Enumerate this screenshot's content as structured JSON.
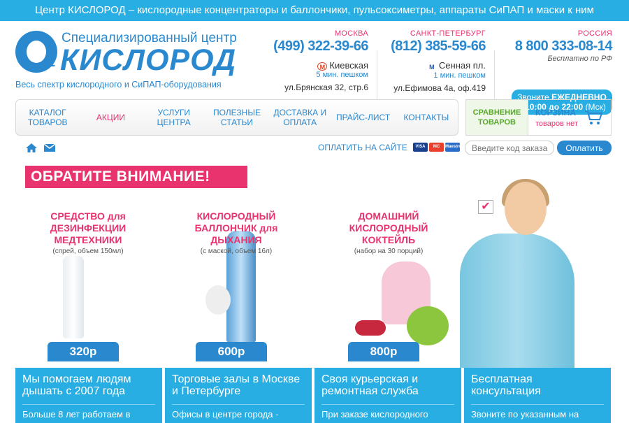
{
  "topbar": {
    "text": "Центр КИСЛОРОД – кислородные концентраторы и баллончики, пульсоксиметры, аппараты СиПАП и маски к ним"
  },
  "logo": {
    "line1": "Специализированный центр",
    "name": "КИСЛОРОД",
    "tagline": "Весь спектр кислородного и СиПАП-оборудования",
    "mark": "2"
  },
  "contacts": [
    {
      "city": "МОСКВА",
      "phone": "(499) 322-39-66",
      "metro": "Киевская",
      "walk": "5 мин. пешком",
      "address": "ул.Брянская 32, стр.6"
    },
    {
      "city": "САНКТ-ПЕТЕРБУРГ",
      "phone": "(812) 385-59-66",
      "metro": "Сенная пл.",
      "walk": "1 мин. пешком",
      "address": "ул.Ефимова 4а, оф.419"
    },
    {
      "city": "РОССИЯ",
      "phone": "8 800 333-08-14",
      "note": "Бесплатно по РФ"
    }
  ],
  "callbox": {
    "prefix": "Звоните",
    "bold1": "ЕЖЕДНЕВНО",
    "line2_bold": "с 10:00 до 22:00",
    "line2_tail": "(Мск)"
  },
  "nav": [
    "КАТАЛОГ ТОВАРОВ",
    "АКЦИИ",
    "УСЛУГИ ЦЕНТРА",
    "ПОЛЕЗНЫЕ СТАТЬИ",
    "ДОСТАВКА И ОПЛАТА",
    "ПРАЙС-ЛИСТ",
    "КОНТАКТЫ"
  ],
  "compare": {
    "label": "СРАВНЕНИЕ ТОВАРОВ"
  },
  "cart": {
    "title": "КОРЗИНА",
    "status": "товаров нет"
  },
  "payment": {
    "label": "ОПЛАТИТЬ НА САЙТЕ",
    "placeholder": "Введите код заказа",
    "button": "Оплатить",
    "cards": [
      "VISA",
      "MC",
      "Maestro"
    ]
  },
  "banner": {
    "notice": "ОБРАТИТЕ ВНИМАНИЕ!",
    "products": [
      {
        "title": "СРЕДСТВО для ДЕЗИНФЕКЦИИ МЕДТЕХНИКИ",
        "sub": "(спрей, объем 150мл)",
        "price": "320р"
      },
      {
        "title": "КИСЛОРОДНЫЙ БАЛЛОНЧИК для ДЫХАНИЯ",
        "sub": "(с маской, объем 16л)",
        "price": "600р"
      },
      {
        "title": "ДОМАШНИЙ КИСЛОРОДНЫЙ КОКТЕЙЛЬ",
        "sub": "(набор на 30 порций)",
        "price": "800р"
      }
    ]
  },
  "features": [
    {
      "title": "Мы помогаем людям дышать с 2007 года",
      "text": "Больше 8 лет работаем в"
    },
    {
      "title": "Торговые залы в Москве и Петербурге",
      "text": "Офисы в центре города -"
    },
    {
      "title": "Своя курьерская и ремонтная служба",
      "text": "При заказе кислородного"
    },
    {
      "title": "Бесплатная консультация",
      "text": "Звоните по указанным на"
    }
  ],
  "colors": {
    "accent": "#29aee3",
    "brand": "#2a88cf",
    "pink": "#e8336e",
    "green": "#5aa82c"
  }
}
